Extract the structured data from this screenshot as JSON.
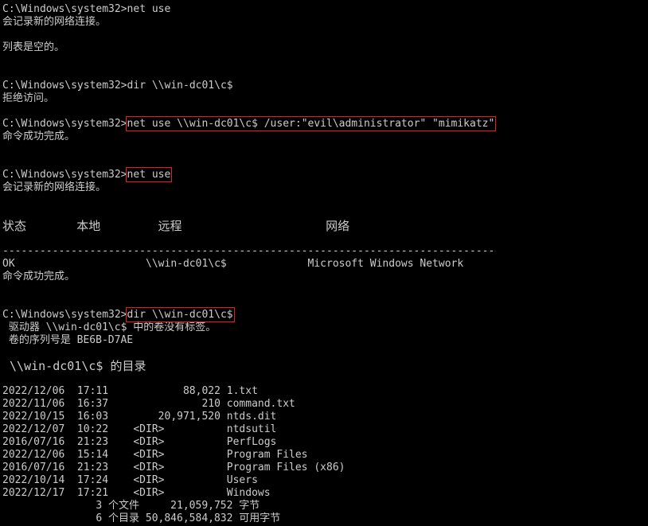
{
  "lines": [
    {
      "prompt": "C:\\Windows\\system32>",
      "cmd": "net use",
      "hl": false
    },
    {
      "text": "会记录新的网络连接。"
    },
    {
      "text": ""
    },
    {
      "text": "列表是空的。"
    },
    {
      "text": ""
    },
    {
      "text": ""
    },
    {
      "prompt": "C:\\Windows\\system32>",
      "cmd": "dir \\\\win-dc01\\c$",
      "hl": false
    },
    {
      "text": "拒绝访问。"
    },
    {
      "text": ""
    },
    {
      "prompt": "C:\\Windows\\system32>",
      "cmd": "net use \\\\win-dc01\\c$ /user:\"evil\\administrator\" \"mimikatz\"",
      "hl": true
    },
    {
      "text": "命令成功完成。"
    },
    {
      "text": ""
    },
    {
      "text": ""
    },
    {
      "prompt": "C:\\Windows\\system32>",
      "cmd": "net use",
      "hl": true
    },
    {
      "text": "会记录新的网络连接。"
    },
    {
      "text": ""
    },
    {
      "text": ""
    },
    {
      "text": "状态       本地        远程                    网络",
      "big": true
    },
    {
      "text": ""
    },
    {
      "text": "-------------------------------------------------------------------------------"
    },
    {
      "text": "OK                     \\\\win-dc01\\c$             Microsoft Windows Network"
    },
    {
      "text": "命令成功完成。"
    },
    {
      "text": ""
    },
    {
      "text": ""
    },
    {
      "prompt": "C:\\Windows\\system32>",
      "cmd": "dir \\\\win-dc01\\c$",
      "hl": true
    },
    {
      "text": " 驱动器 \\\\win-dc01\\c$ 中的卷没有标签。"
    },
    {
      "text": " 卷的序列号是 BE6B-D7AE"
    },
    {
      "text": ""
    },
    {
      "text": " \\\\win-dc01\\c$ 的目录",
      "big": true
    },
    {
      "text": ""
    },
    {
      "text": "2022/12/06  17:11            88,022 1.txt"
    },
    {
      "text": "2022/11/06  16:37               210 command.txt"
    },
    {
      "text": "2022/10/15  16:03        20,971,520 ntds.dit"
    },
    {
      "text": "2022/12/07  10:22    <DIR>          ntdsutil"
    },
    {
      "text": "2016/07/16  21:23    <DIR>          PerfLogs"
    },
    {
      "text": "2022/12/06  15:14    <DIR>          Program Files"
    },
    {
      "text": "2016/07/16  21:23    <DIR>          Program Files (x86)"
    },
    {
      "text": "2022/10/14  17:24    <DIR>          Users"
    },
    {
      "text": "2022/12/17  17:21    <DIR>          Windows"
    },
    {
      "text": "               3 个文件     21,059,752 字节"
    },
    {
      "text": "               6 个目录 50,846,584,832 可用字节"
    }
  ],
  "colors": {
    "background": "#000000",
    "foreground": "#cccccc",
    "highlight": "#e02020"
  }
}
